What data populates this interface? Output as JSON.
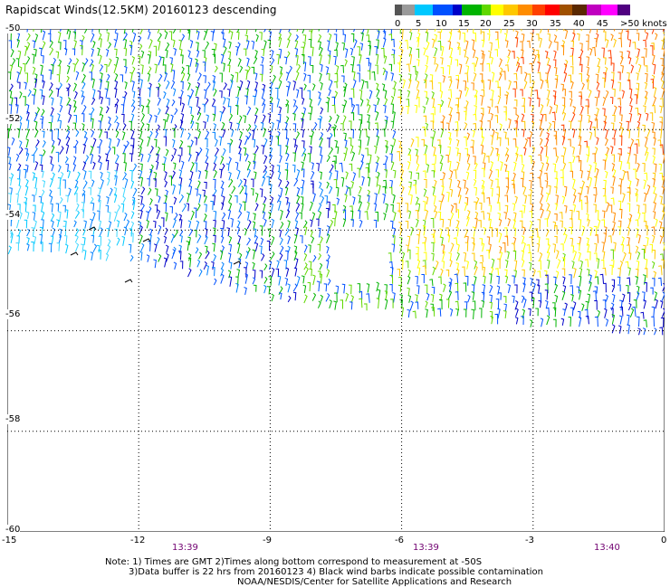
{
  "title": "Rapidscat Winds(12.5KM) 20160123 descending",
  "colorbar": {
    "colors": [
      "#555555",
      "#9a9a9a",
      "#00c8ff",
      "#0050ff",
      "#0000c8",
      "#00b400",
      "#60d800",
      "#ffff00",
      "#ffc800",
      "#ff8c00",
      "#ff0000",
      "#a05000",
      "#5a2800",
      "#a000a0",
      "#ff00ff",
      "#500080"
    ],
    "labels": [
      "0",
      "5",
      "10",
      "15",
      "20",
      "25",
      "30",
      "35",
      "40",
      "45",
      ">50 knots"
    ]
  },
  "axes": {
    "x_ticks": [
      "-15",
      "-12",
      "-9",
      "-6",
      "-3",
      "0"
    ],
    "y_ticks": [
      "-50",
      "-52",
      "-54",
      "-56",
      "-58",
      "-60"
    ]
  },
  "times": [
    "13:39",
    "13:39",
    "13:40"
  ],
  "notes": {
    "line1": "Note: 1) Times are GMT 2)Times along bottom correspond to measurement at -50S",
    "line2": "3)Data buffer is 22 hrs from 20160123 4) Black wind barbs indicate possible contamination",
    "line3": "NOAA/NESDIS/Center for Satellite Applications and Research"
  },
  "map_data": {
    "lon_range": [
      -15,
      0
    ],
    "lat_range": [
      -60,
      -50
    ],
    "gridlines": "dotted"
  }
}
